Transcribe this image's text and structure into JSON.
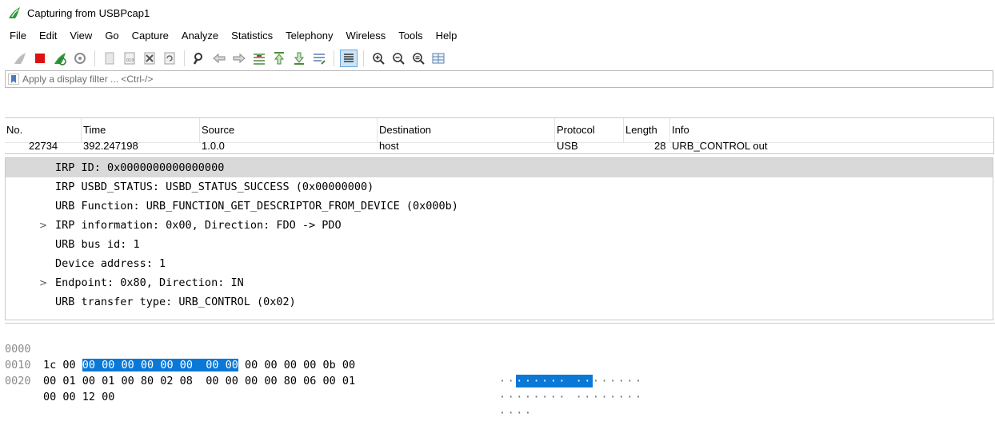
{
  "window": {
    "title": "Capturing from USBPcap1",
    "icon": "wireshark-fin-icon"
  },
  "menu": [
    "File",
    "Edit",
    "View",
    "Go",
    "Capture",
    "Analyze",
    "Statistics",
    "Telephony",
    "Wireless",
    "Tools",
    "Help"
  ],
  "toolbar": {
    "icons": [
      "start-capture-icon",
      "stop-capture-icon",
      "restart-capture-icon",
      "capture-options-icon",
      "open-file-icon",
      "save-file-icon",
      "close-file-icon",
      "reload-file-icon",
      "find-packet-icon",
      "go-back-icon",
      "go-forward-icon",
      "go-to-packet-icon",
      "first-packet-icon",
      "last-packet-icon",
      "autoscroll-icon",
      "colorize-icon",
      "zoom-in-icon",
      "zoom-out-icon",
      "zoom-normal-icon",
      "resize-columns-icon"
    ]
  },
  "filter": {
    "placeholder": "Apply a display filter ... <Ctrl-/>"
  },
  "packet_list": {
    "columns": [
      "No.",
      "Time",
      "Source",
      "Destination",
      "Protocol",
      "Length",
      "Info"
    ],
    "row": [
      "22734",
      "392.247198",
      "1.0.0",
      "host",
      "USB",
      "28",
      "URB_CONTROL out"
    ]
  },
  "details": {
    "lines": [
      {
        "text": "IRP ID: 0x0000000000000000",
        "expandable": false,
        "selected": true
      },
      {
        "text": "IRP USBD_STATUS: USBD_STATUS_SUCCESS (0x00000000)",
        "expandable": false,
        "selected": false
      },
      {
        "text": "URB Function: URB_FUNCTION_GET_DESCRIPTOR_FROM_DEVICE (0x000b)",
        "expandable": false,
        "selected": false
      },
      {
        "text": "IRP information: 0x00, Direction: FDO -> PDO",
        "expandable": true,
        "selected": false
      },
      {
        "text": "URB bus id: 1",
        "expandable": false,
        "selected": false
      },
      {
        "text": "Device address: 1",
        "expandable": false,
        "selected": false
      },
      {
        "text": "Endpoint: 0x80, Direction: IN",
        "expandable": true,
        "selected": false
      },
      {
        "text": "URB transfer type: URB_CONTROL (0x02)",
        "expandable": false,
        "selected": false
      }
    ]
  },
  "bytes": {
    "highlight_color": "#0a78d7",
    "rows": [
      {
        "offset": "0000",
        "pre": "1c 00 ",
        "hl": "00 00 00 00 00 00  00 00",
        "post": " 00 00 00 00 0b 00",
        "ascii_pre": "··",
        "ascii_hl": "······ ··",
        "ascii_post": "······"
      },
      {
        "offset": "0010",
        "pre": "00 01 00 01 00 80 02 08  00 00 00 00 80 06 00 01",
        "hl": "",
        "post": "",
        "ascii_pre": "········ ········",
        "ascii_hl": "",
        "ascii_post": ""
      },
      {
        "offset": "0020",
        "pre": "00 00 12 00",
        "hl": "",
        "post": "",
        "ascii_pre": "····",
        "ascii_hl": "",
        "ascii_post": ""
      }
    ]
  }
}
